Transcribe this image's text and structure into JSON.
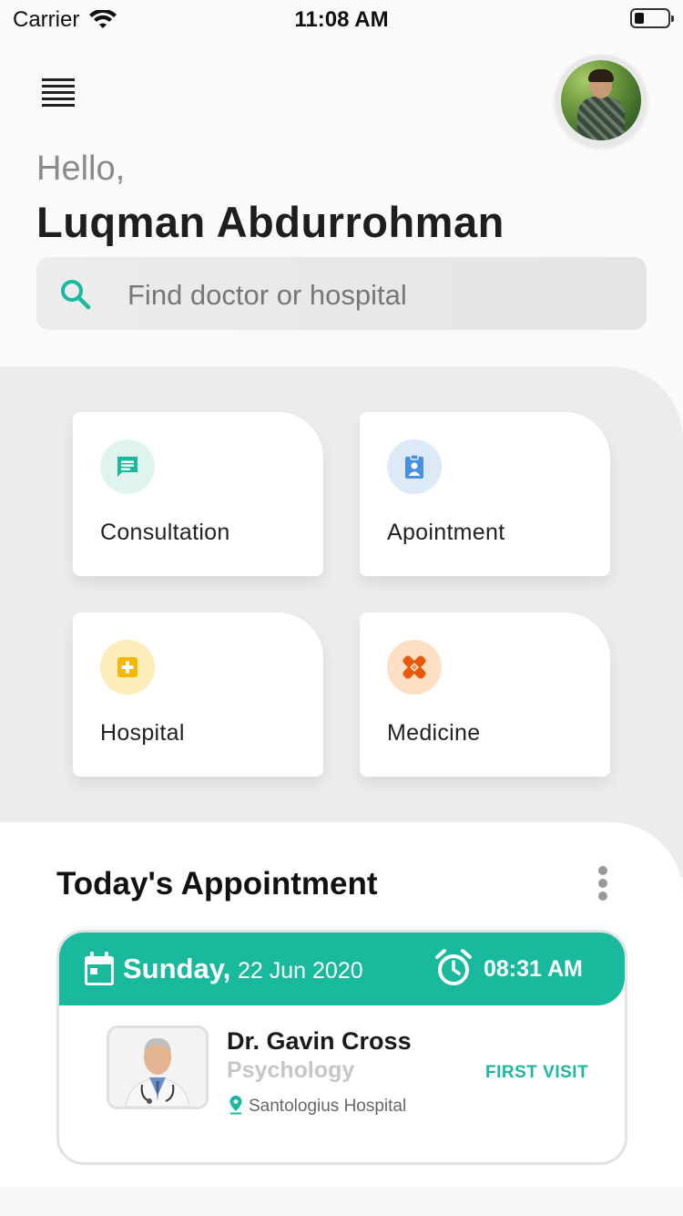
{
  "status_bar": {
    "carrier": "Carrier",
    "time": "11:08 AM"
  },
  "header": {
    "greeting": "Hello,",
    "user_name": "Luqman Abdurrohman",
    "search_placeholder": "Find doctor or hospital"
  },
  "services": [
    {
      "label": "Consultation",
      "icon": "chat-icon",
      "icon_bg": "#dff3ef",
      "icon_color": "#19b99e"
    },
    {
      "label": "Apointment",
      "icon": "clipboard-user-icon",
      "icon_bg": "#dceaf8",
      "icon_color": "#4a90e2"
    },
    {
      "label": "Hospital",
      "icon": "hospital-cross-icon",
      "icon_bg": "#fdecb7",
      "icon_color": "#f5b800"
    },
    {
      "label": "Medicine",
      "icon": "bandage-icon",
      "icon_bg": "#fde0c4",
      "icon_color": "#e8590c"
    }
  ],
  "appointment_section": {
    "title": "Today's Appointment",
    "card": {
      "day": "Sunday,",
      "date": "22 Jun 2020",
      "time": "08:31 AM",
      "doctor_name": "Dr. Gavin Cross",
      "specialty": "Psychology",
      "hospital": "Santologius Hospital",
      "visit_type": "FIRST VISIT"
    }
  },
  "colors": {
    "accent": "#19b99e"
  }
}
